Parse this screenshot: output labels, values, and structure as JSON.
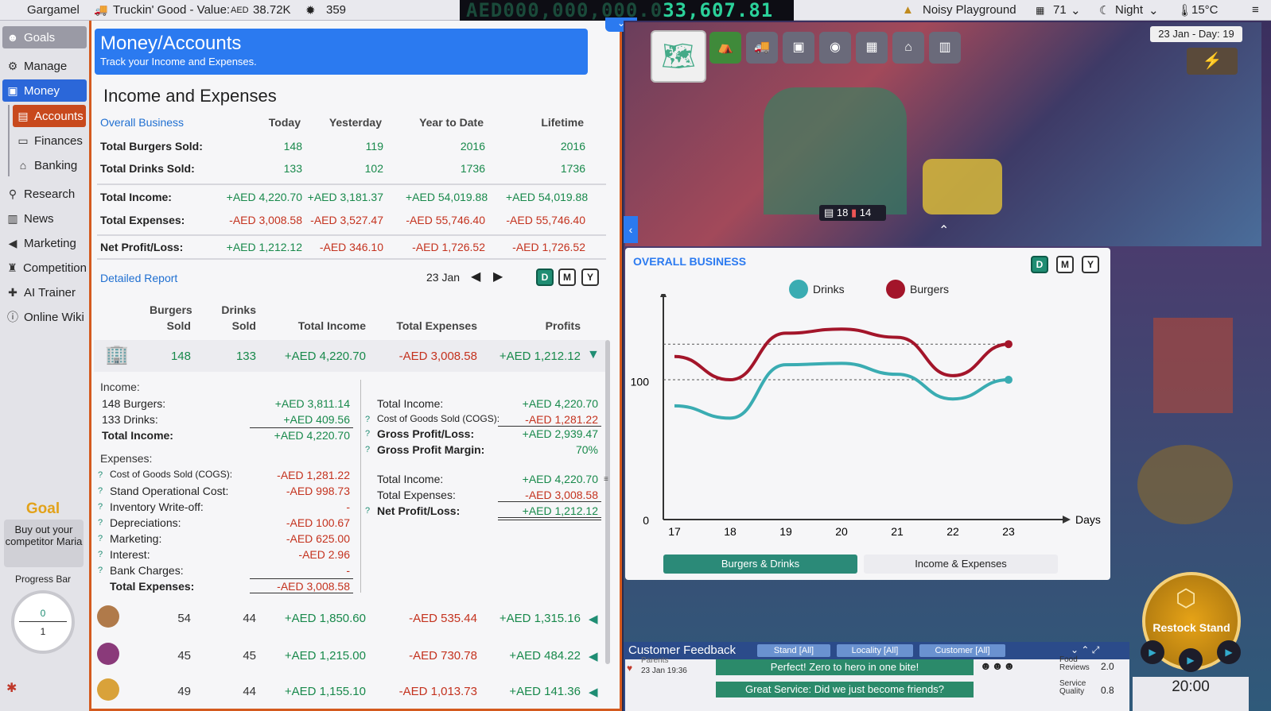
{
  "topbar": {
    "player": "Gargamel",
    "business": "Truckin' Good - Value:",
    "currency": "AED",
    "value": "38.72K",
    "reputation": "359",
    "money_dim": "AED000,000,000.0",
    "money_bright": "33,607.81",
    "location": "Noisy Playground",
    "population": "71",
    "time_of_day": "Night",
    "temperature": "15°C"
  },
  "sidebar": {
    "items": [
      {
        "label": "Goals"
      },
      {
        "label": "Manage"
      },
      {
        "label": "Money"
      },
      {
        "label": "Accounts"
      },
      {
        "label": "Finances"
      },
      {
        "label": "Banking"
      },
      {
        "label": "Research"
      },
      {
        "label": "News"
      },
      {
        "label": "Marketing"
      },
      {
        "label": "Competition"
      },
      {
        "label": "AI Trainer"
      },
      {
        "label": "Online Wiki"
      }
    ],
    "goal_title": "Goal",
    "goal_text": "Buy out your competitor Maria",
    "progress_label": "Progress Bar",
    "progress_value": "0",
    "progress_total": "1",
    "progress_fraction": 0
  },
  "header": {
    "title": "Money/Accounts",
    "subtitle": "Track your Income and Expenses."
  },
  "summary": {
    "title": "Income and Expenses",
    "scope": "Overall Business",
    "columns": [
      "Today",
      "Yesterday",
      "Year to Date",
      "Lifetime"
    ],
    "rows": [
      {
        "label": "Total Burgers Sold:",
        "values": [
          "148",
          "119",
          "2016",
          "2016"
        ],
        "tone": "g"
      },
      {
        "label": "Total Drinks Sold:",
        "values": [
          "133",
          "102",
          "1736",
          "1736"
        ],
        "tone": "g"
      },
      {
        "label": "Total Income:",
        "values": [
          "+AED 4,220.70",
          "+AED 3,181.37",
          "+AED 54,019.88",
          "+AED 54,019.88"
        ],
        "tone": "g"
      },
      {
        "label": "Total Expenses:",
        "values": [
          "-AED 3,008.58",
          "-AED 3,527.47",
          "-AED 55,746.40",
          "-AED 55,746.40"
        ],
        "tone": "r"
      },
      {
        "label": "Net Profit/Loss:",
        "values": [
          "+AED 1,212.12",
          "-AED 346.10",
          "-AED 1,726.52",
          "-AED 1,726.52"
        ],
        "tones": [
          "g",
          "r",
          "r",
          "r"
        ]
      }
    ]
  },
  "detail": {
    "title": "Detailed Report",
    "date": "23 Jan",
    "period_buttons": [
      "D",
      "M",
      "Y"
    ],
    "headers": {
      "burgers": "Burgers",
      "burgers2": "Sold",
      "drinks": "Drinks",
      "drinks2": "Sold",
      "income": "Total Income",
      "expenses": "Total Expenses",
      "profits": "Profits"
    },
    "main_row": {
      "burgers": "148",
      "drinks": "133",
      "income": "+AED 4,220.70",
      "expenses": "-AED 3,008.58",
      "profit": "+AED 1,212.12"
    },
    "income_label": "Income:",
    "income_items": [
      {
        "label": "148 Burgers:",
        "value": "+AED 3,811.14"
      },
      {
        "label": "133 Drinks:",
        "value": "+AED 409.56"
      },
      {
        "label": "Total Income:",
        "value": "+AED 4,220.70"
      }
    ],
    "expenses_label": "Expenses:",
    "expense_items": [
      {
        "label": "Cost of Goods Sold (COGS):",
        "value": "-AED 1,281.22"
      },
      {
        "label": "Stand Operational Cost:",
        "value": "-AED 998.73"
      },
      {
        "label": "Inventory Write-off:",
        "value": "-"
      },
      {
        "label": "Depreciations:",
        "value": "-AED 100.67"
      },
      {
        "label": "Marketing:",
        "value": "-AED 625.00"
      },
      {
        "label": "Interest:",
        "value": "-AED 2.96"
      },
      {
        "label": "Bank Charges:",
        "value": "-"
      },
      {
        "label": "Total Expenses:",
        "value": "-AED 3,008.58"
      }
    ],
    "right_items": [
      {
        "label": "Total Income:",
        "value": "+AED 4,220.70"
      },
      {
        "label": "Cost of Goods Sold (COGS):",
        "value": "-AED 1,281.22"
      },
      {
        "label": "Gross Profit/Loss:",
        "value": "+AED 2,939.47"
      },
      {
        "label": "Gross Profit Margin:",
        "value": "70%"
      },
      {
        "label": "Total Income:",
        "value": "+AED 4,220.70"
      },
      {
        "label": "Total Expenses:",
        "value": "-AED 3,008.58"
      },
      {
        "label": "Net Profit/Loss:",
        "value": "+AED 1,212.12"
      }
    ],
    "stand_rows": [
      {
        "burgers": "54",
        "drinks": "44",
        "income": "+AED 1,850.60",
        "expenses": "-AED 535.44",
        "profit": "+AED 1,315.16"
      },
      {
        "burgers": "45",
        "drinks": "45",
        "income": "+AED 1,215.00",
        "expenses": "-AED 730.78",
        "profit": "+AED 484.22"
      },
      {
        "burgers": "49",
        "drinks": "44",
        "income": "+AED 1,155.10",
        "expenses": "-AED 1,013.73",
        "profit": "+AED 141.36"
      }
    ]
  },
  "game": {
    "date": "23 Jan - Day: 19",
    "stand_burgers": "18",
    "stand_drinks": "14",
    "restock": "Restock Stand",
    "clock": "20:00"
  },
  "chart_panel": {
    "title": "OVERALL BUSINESS",
    "tabs": [
      "Burgers & Drinks",
      "Income & Expenses"
    ]
  },
  "chart_data": {
    "type": "line",
    "title": "OVERALL BUSINESS",
    "xlabel": "Days",
    "ylabel": "",
    "x": [
      17,
      18,
      19,
      20,
      21,
      22,
      23
    ],
    "series": [
      {
        "name": "Drinks",
        "color": "#3aacb2",
        "values": [
          83,
          74,
          113,
          114,
          106,
          88,
          102
        ]
      },
      {
        "name": "Burgers",
        "color": "#a3152a",
        "values": [
          119,
          102,
          136,
          139,
          133,
          105,
          128
        ]
      }
    ],
    "yticks": [
      0,
      100
    ],
    "ylim": [
      0,
      160
    ],
    "reference_lines": [
      102,
      128
    ],
    "legend": "top"
  },
  "feedback": {
    "title": "Customer Feedback",
    "filters": [
      "Stand [All]",
      "Locality [All]",
      "Customer [All]"
    ],
    "who": "Parents",
    "when": "23 Jan 19:36",
    "messages": [
      "Perfect! Zero to hero in one bite!",
      "Great Service: Did we just become friends?"
    ],
    "metrics": [
      {
        "label": "Food Reviews",
        "value": "2.0"
      },
      {
        "label": "Service Quality",
        "value": "0.8"
      }
    ]
  }
}
